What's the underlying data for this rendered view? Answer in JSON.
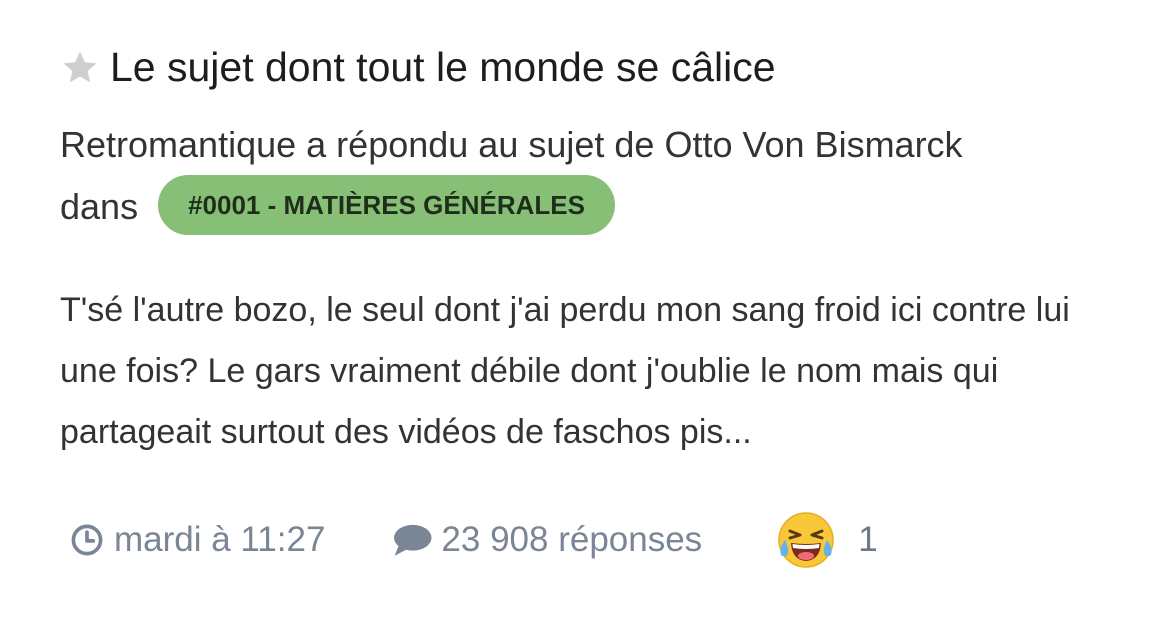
{
  "post": {
    "title": "Le sujet dont tout le monde se câlice",
    "author": "Retromantique",
    "action_text": "a répondu au sujet de",
    "topic_author": "Otto Von Bismarck",
    "in_text": "dans",
    "category": "#0001 - MATIÈRES GÉNÉRALES",
    "excerpt": "T'sé l'autre bozo, le seul dont j'ai perdu mon sang froid ici contre lui une fois? Le gars vraiment débile dont j'oublie le nom mais qui partageait surtout des vidéos de faschos pis..."
  },
  "footer": {
    "time": "mardi à 11:27",
    "replies": "23 908 réponses",
    "reaction_count": "1",
    "reaction_emoji": "laughing-tears-icon"
  },
  "colors": {
    "badge_bg": "#86bf75",
    "meta_gray": "#7a8595",
    "star_gray": "#cfcfcf"
  }
}
